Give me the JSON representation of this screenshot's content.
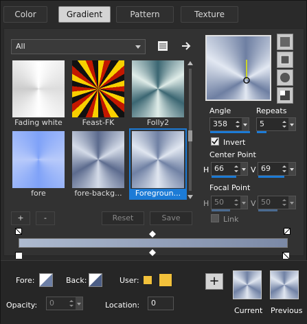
{
  "tabs": [
    {
      "label": "Color"
    },
    {
      "label": "Gradient"
    },
    {
      "label": "Pattern"
    },
    {
      "label": "Texture"
    }
  ],
  "filter": {
    "value": "All"
  },
  "swatches": [
    {
      "label": "Fading white"
    },
    {
      "label": "Feast-FK"
    },
    {
      "label": "Folly2"
    },
    {
      "label": "fore"
    },
    {
      "label": "fore-backg..."
    },
    {
      "label": "Foregroun..."
    }
  ],
  "angle": {
    "label": "Angle",
    "value": "358"
  },
  "repeats": {
    "label": "Repeats",
    "value": "5"
  },
  "invert": {
    "label": "Invert",
    "checked": true
  },
  "center": {
    "label": "Center Point",
    "h_label": "H",
    "h_value": "66",
    "v_label": "V",
    "v_value": "69"
  },
  "focal": {
    "label": "Focal Point",
    "h_label": "H",
    "h_value": "50",
    "v_label": "V",
    "v_value": "50"
  },
  "link": {
    "label": "Link"
  },
  "buttons": {
    "plus": "+",
    "minus": "-",
    "reset": "Reset",
    "save": "Save"
  },
  "bottom": {
    "fore_label": "Fore:",
    "back_label": "Back:",
    "user_label": "User:",
    "opacity_label": "Opacity:",
    "opacity_value": "0",
    "location_label": "Location:",
    "location_value": "0",
    "current_label": "Current",
    "previous_label": "Previous",
    "add": "+"
  },
  "colors": {
    "accent": "#1c7bd6",
    "user1": "#f2c13b"
  }
}
